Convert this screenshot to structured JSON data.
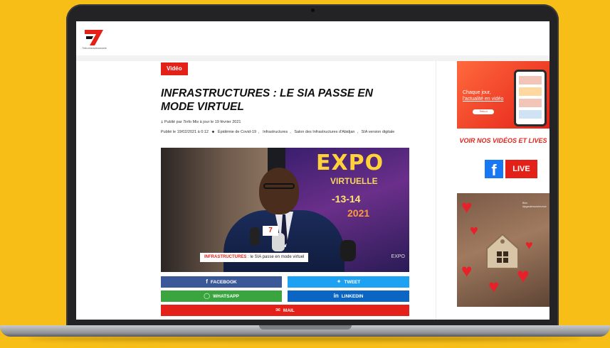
{
  "site": {
    "logo_text": "7",
    "logo_subtitle": "7info.ci/actu/economie"
  },
  "article": {
    "category_tag": "Vidéo",
    "headline": "INFRASTRUCTURES : LE SIA PASSE EN MODE VIRTUEL",
    "author_line": "Publié par 7info  Mis à jour le 19 février 2021",
    "published_line": "Publié le 19/02/2021 à 0:12",
    "tags": [
      "Épidémie de Covid-19",
      "Infrastructures",
      "Salon des Infrastructures d'Abidjan",
      "SIA version digitale"
    ]
  },
  "video": {
    "banner_word": "EXPO",
    "banner_sub": "VIRTUELLE",
    "banner_dates": "-13-14",
    "banner_year": "2021",
    "mic_logo": "7",
    "lower_third_bold": "INFRASTRUCTURES",
    "lower_third_rest": " : le SIA passe en mode virtuel",
    "corner_logo": "EXPO"
  },
  "share": {
    "facebook": "FACEBOOK",
    "tweet": "TWEET",
    "whatsapp": "WHATSAPP",
    "linkedin": "LINKEDIN",
    "mail": "MAIL"
  },
  "sidebar": {
    "ad1_line1": "Chaque jour,",
    "ad1_line2": "l'actualité en vidéo",
    "ad1_pill": "7info.ci",
    "voir_label": "VOIR NOS VIDÉOS ET LIVES",
    "fb_letter": "f",
    "live_label": "LIVE",
    "ad2_caption": "Bien #jegardemonchezmoi"
  },
  "colors": {
    "background": "#F7BE18",
    "brand_red": "#e32118",
    "facebook": "#3b5998",
    "twitter": "#1da1f2",
    "whatsapp": "#3aa53f",
    "linkedin": "#0a66c2"
  }
}
